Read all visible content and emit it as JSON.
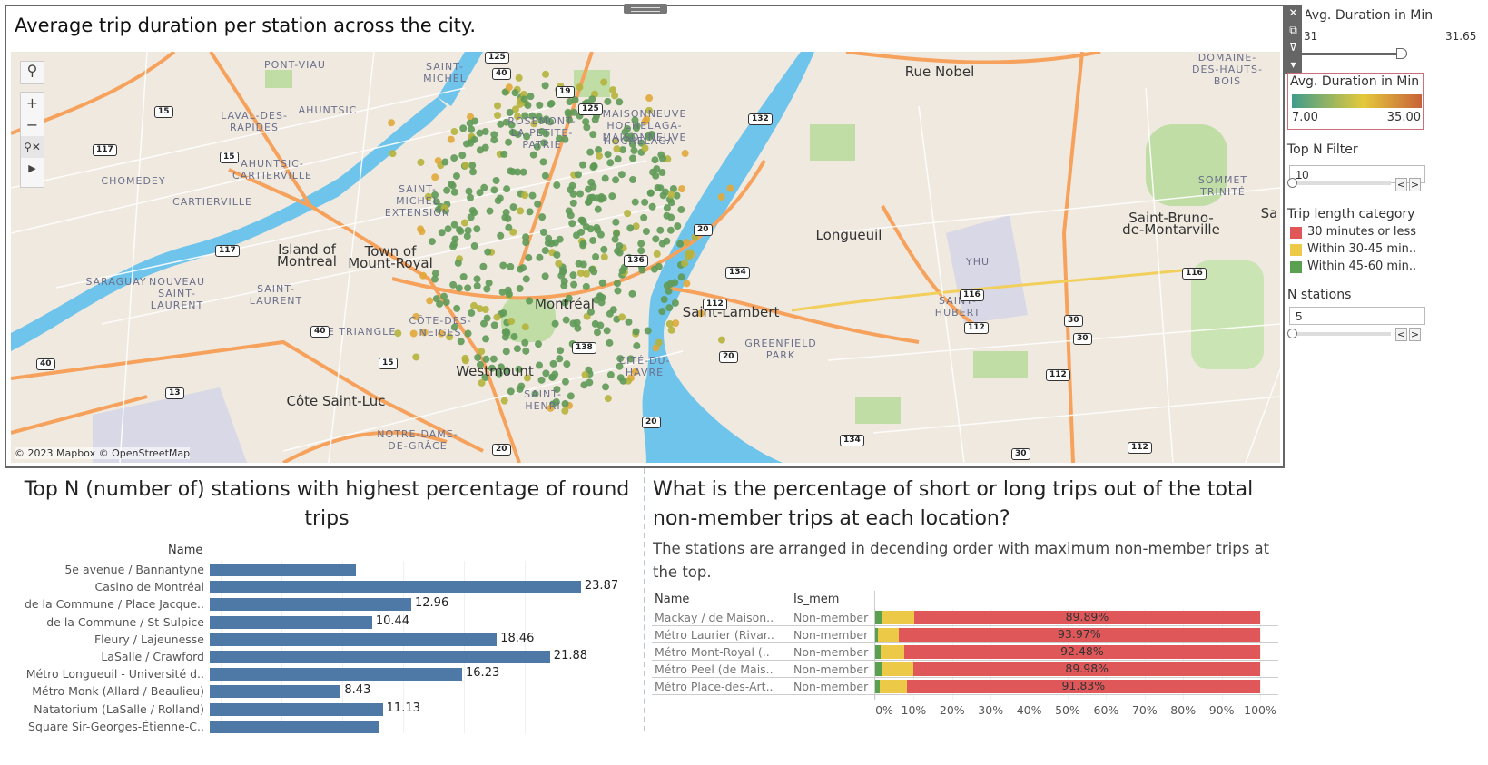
{
  "map_sheet": {
    "title": "Average trip duration per station across the city.",
    "copyright": "© 2023 Mapbox © OpenStreetMap",
    "places": [
      "PONT-VIAU",
      "SAINT-\nMICHEL",
      "LAVAL-DES-\nRAPIDES",
      "AHUNTSIC",
      "ROSEMONT-\nLA PETITE-\nPATRIE",
      "MAISONNEUVE\nHOCHELAGA-\nMAISONNEUVE",
      "HOCHELAGA",
      "AHUNTSIC-\nCARTIERVILLE",
      "CHOMEDEY",
      "CARTIERVILLE",
      "SAINT-\nMICHEL\nEXTENSION",
      "Town of\nMount-Royal",
      "Island of\nMontreal",
      "SARAGUAY",
      "NOUVEAU\nSAINT-\nLAURENT",
      "SAINT-\nLAURENT",
      "LE TRIANGLE",
      "CÔTE-DES-\nNEIGES",
      "Montréal",
      "CITÉ-DU-\nHAVRE",
      "Saint-Lambert",
      "GREENFIELD\nPARK",
      "Westmount",
      "Côte Saint-Luc",
      "NOTRE-DAME-\nDE-GRÂCE",
      "SAINT-\nHENRI",
      "Longueuil",
      "Saint-Bruno-\nde-Montarville",
      "YHU",
      "SAINT-\nHUBERT",
      "SOMMET\nTRINITÉ",
      "DOMAINE-\nDES-HAUTS-\nBOIS",
      "Rue Nobel",
      "Sa"
    ],
    "shields": [
      "15",
      "117",
      "125",
      "40",
      "19",
      "125",
      "132",
      "15",
      "117",
      "20",
      "134",
      "136",
      "112",
      "116",
      "30",
      "40",
      "13",
      "20",
      "40",
      "15",
      "138",
      "20",
      "134",
      "30",
      "112",
      "116",
      "112",
      "30",
      "112",
      "20"
    ],
    "dot_colors": {
      "low": "#5f9a58",
      "mid": "#b5b23c",
      "high": "#e0a93a"
    },
    "tools": {
      "search": "search-icon",
      "zoom_in": "+",
      "zoom_out": "−",
      "pan": "▶"
    }
  },
  "toolbar": {
    "close": "✕",
    "popout": "⧉",
    "filter": "⊽",
    "more": "▾"
  },
  "right_panel": {
    "duration_filter": {
      "title": "Avg. Duration in Min",
      "min_label": "31",
      "max_label": "31.65"
    },
    "color_legend": {
      "title": "Avg. Duration in Min",
      "min": "7.00",
      "max": "35.00",
      "colors": [
        "#3f9c8c",
        "#e4c93b",
        "#c8623a"
      ]
    },
    "top_n": {
      "title": "Top N Filter",
      "value": "10"
    },
    "trip_legend": {
      "title": "Trip length category",
      "items": [
        {
          "label": "30 minutes or less",
          "color": "#e05759"
        },
        {
          "label": "Within 30-45 min..",
          "color": "#edc948"
        },
        {
          "label": "Within 45-60 min..",
          "color": "#59a14f"
        }
      ]
    },
    "n_stations": {
      "title": "N stations",
      "value": "5"
    }
  },
  "round_trips": {
    "title": "Top N (number of) stations with highest percentage of round trips",
    "header": "Name",
    "chart_data": {
      "type": "bar",
      "orientation": "horizontal",
      "color": "#4e79a7",
      "categories": [
        "5e avenue / Bannantyne",
        "Casino de Montréal",
        "de la Commune / Place Jacque..",
        "de la Commune / St-Sulpice",
        "Fleury / Lajeunesse",
        "LaSalle / Crawford",
        "Métro Longueuil - Université d..",
        "Métro Monk (Allard / Beaulieu)",
        "Natatorium (LaSalle / Rolland)",
        "Square Sir-Georges-Étienne-C.."
      ],
      "values": [
        9.4,
        23.87,
        12.96,
        10.44,
        18.46,
        21.88,
        16.23,
        8.43,
        11.13,
        10.9
      ],
      "labels": [
        "",
        "23.87",
        "12.96",
        "10.44",
        "18.46",
        "21.88",
        "16.23",
        "8.43",
        "11.13",
        ""
      ]
    }
  },
  "non_member": {
    "title": "What is the percentage of short or long trips out of the total non-member trips at each location?",
    "subtitle": "The stations are arranged in decending order with maximum non-member trips at the top.",
    "headers": [
      "Name",
      "Is_mem"
    ],
    "chart_data": {
      "type": "bar",
      "stacked": true,
      "orientation": "horizontal",
      "categories": [
        "Mackay / de Maison..",
        "Métro Laurier (Rivar..",
        "Métro Mont-Royal (..",
        "Métro Peel (de Mais..",
        "Métro Place-des-Art.."
      ],
      "is_mem": [
        "Non-member",
        "Non-member",
        "Non-member",
        "Non-member",
        "Non-member"
      ],
      "series": [
        {
          "name": "Within 45-60 min..",
          "color": "#59a14f",
          "values": [
            1.9,
            0.7,
            1.4,
            1.8,
            1.1
          ]
        },
        {
          "name": "Within 30-45 min..",
          "color": "#edc948",
          "values": [
            8.21,
            5.33,
            6.12,
            8.22,
            7.07
          ]
        },
        {
          "name": "30 minutes or less",
          "color": "#e05759",
          "values": [
            89.89,
            93.97,
            92.48,
            89.98,
            91.83
          ]
        }
      ],
      "labels": [
        "89.89%",
        "93.97%",
        "92.48%",
        "89.98%",
        "91.83%"
      ],
      "xticks": [
        "0%",
        "10%",
        "20%",
        "30%",
        "40%",
        "50%",
        "60%",
        "70%",
        "80%",
        "90%",
        "100%"
      ],
      "xlim": [
        0,
        100
      ]
    }
  }
}
